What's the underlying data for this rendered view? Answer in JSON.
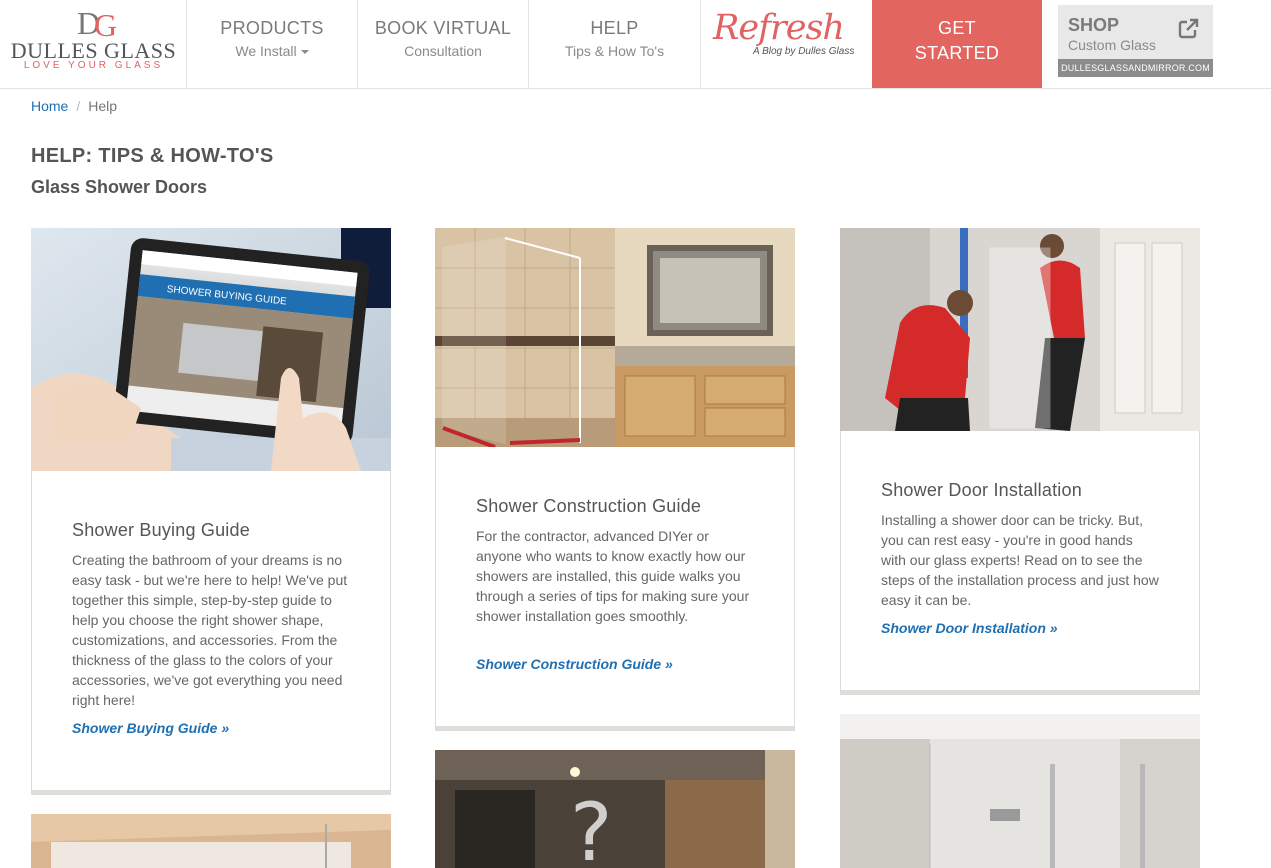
{
  "logo": {
    "monogram": "DG",
    "name": "DULLES GLASS",
    "tagline": "LOVE YOUR GLASS"
  },
  "nav": {
    "items": [
      {
        "main": "PRODUCTS",
        "sub": "We Install"
      },
      {
        "main": "BOOK VIRTUAL",
        "sub": "Consultation"
      },
      {
        "main": "HELP",
        "sub": "Tips & How To's"
      }
    ],
    "blog": {
      "title": "Refresh",
      "subtitle": "A Blog by Dulles Glass"
    },
    "cta": {
      "line1": "GET",
      "line2": "STARTED"
    },
    "shop": {
      "title": "SHOP",
      "subtitle": "Custom Glass",
      "url": "DULLESGLASSANDMIRROR.COM"
    }
  },
  "breadcrumb": {
    "home": "Home",
    "current": "Help"
  },
  "page": {
    "title": "HELP: TIPS & HOW-TO'S",
    "subtitle": "Glass Shower Doors"
  },
  "cards": [
    {
      "title": "Shower Buying Guide",
      "text": "Creating the bathroom of your dreams is no easy task - but we're here to help! We've put together this simple, step-by-step guide to help you choose the right shower shape, customizations, and accessories. From the thickness of the glass to the colors of your accessories, we've got everything you need right here!",
      "link": "Shower Buying Guide »",
      "image_text": "SHOWER BUYING GUIDE"
    },
    {
      "title": "Shower Construction Guide",
      "text": "For the contractor, advanced DIYer or anyone who wants to know exactly how our showers are installed, this guide walks you through a series of tips for making sure your shower installation goes smoothly.",
      "link": "Shower Construction Guide »"
    },
    {
      "title": "Shower Door Installation",
      "text": "Installing a shower door can be tricky. But, you can rest easy - you're in good hands with our glass experts! Read on to see the steps of the installation process and just how easy it can be.",
      "link": "Shower Door Installation »"
    }
  ],
  "colors": {
    "accent": "#e36560",
    "link": "#1f6fb2",
    "text": "#555555"
  }
}
